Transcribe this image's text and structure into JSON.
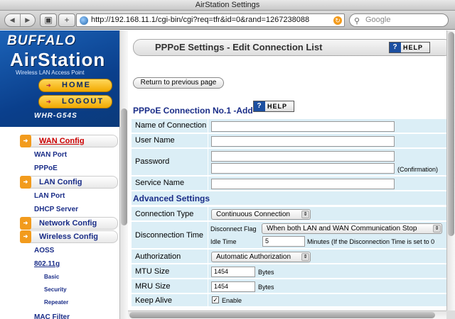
{
  "window": {
    "title": "AirStation Settings"
  },
  "toolbar": {
    "back_icon": "back-arrow-icon",
    "forward_icon": "forward-arrow-icon",
    "url": "http://192.168.11.1/cgi-bin/cgi?req=tfr&id=0&rand=1267238088",
    "search_placeholder": "Google"
  },
  "brand": {
    "logo": "BUFFALO",
    "product": "AirStation",
    "tagline": "Wireless LAN Access Point",
    "model": "WHR-G54S",
    "home_label": "HOME",
    "logout_label": "LOGOUT"
  },
  "menu": {
    "wan_config": "WAN Config",
    "wan_port": "WAN Port",
    "pppoe": "PPPoE",
    "lan_config": "LAN Config",
    "lan_port": "LAN Port",
    "dhcp_server": "DHCP Server",
    "network_config": "Network Config",
    "wireless_config": "Wireless Config",
    "aoss": "AOSS",
    "dot11g": "802.11g",
    "basic": "Basic",
    "security": "Security",
    "repeater": "Repeater",
    "mac_filter": "MAC Filter"
  },
  "main": {
    "page_title": "PPPoE Settings - Edit Connection List",
    "help_label": "HELP",
    "back_button": "Return to previous page",
    "connection_title": "PPPoE Connection No.1 -Add",
    "fields": {
      "name_label": "Name of Connection",
      "user_label": "User Name",
      "password_label": "Password",
      "confirmation": "(Confirmation)",
      "service_label": "Service Name"
    },
    "advanced_title": "Advanced Settings",
    "advanced": {
      "connection_type_label": "Connection Type",
      "connection_type_value": "Continuous Connection",
      "disconnection_label": "Disconnection Time",
      "disconnect_flag_label": "Disconnect Flag",
      "disconnect_flag_value": "When both LAN and WAN Communication Stop",
      "idle_time_label": "Idle Time",
      "idle_time_value": "5",
      "idle_time_note": "Minutes (If the Disconnection Time is set to 0",
      "authorization_label": "Authorization",
      "authorization_value": "Automatic Authorization",
      "mtu_label": "MTU Size",
      "mtu_value": "1454",
      "mru_label": "MRU Size",
      "mru_value": "1454",
      "bytes": "Bytes",
      "keepalive_label": "Keep Alive",
      "keepalive_value": "Enable"
    }
  }
}
